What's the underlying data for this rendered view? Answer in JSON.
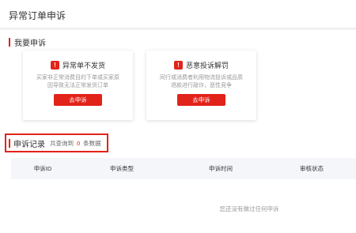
{
  "page": {
    "title": "异常订单申诉"
  },
  "appeal_section": {
    "title": "我要申诉"
  },
  "cards": [
    {
      "title": "异常单不发货",
      "desc": "买家非正常消费目的下单或买家原因导致无法正常发货订单",
      "button": "去申诉",
      "icon": "warning-icon"
    },
    {
      "title": "恶意投诉解罚",
      "desc": "同行或消费者利用物流投诉或品质退款进行敲诈，恶性竞争",
      "button": "去申诉",
      "icon": "warning-icon"
    }
  ],
  "records": {
    "title": "申诉记录",
    "count_prefix": "共查询到",
    "count": "0",
    "count_suffix": "条数据"
  },
  "table": {
    "columns": [
      "申诉ID",
      "申诉类型",
      "申诉时间",
      "审核状态"
    ],
    "empty_text": "您还没有做过任何申诉"
  },
  "colors": {
    "accent": "#e2231a"
  }
}
